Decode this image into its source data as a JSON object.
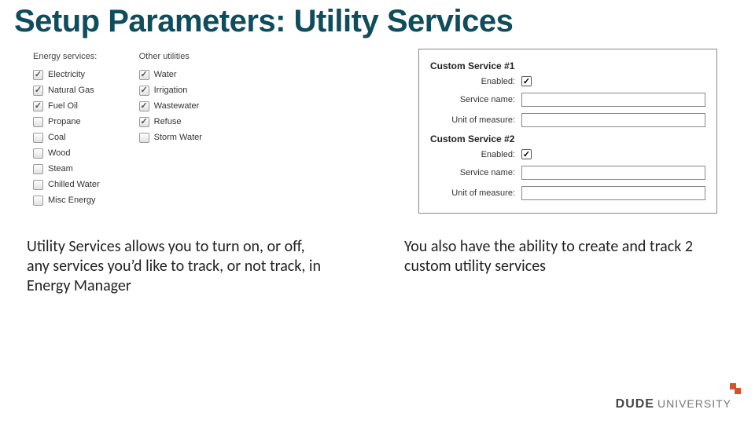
{
  "title": "Setup Parameters: Utility Services",
  "energy_header": "Energy services:",
  "other_header": "Other utilities",
  "energy_services": [
    {
      "label": "Electricity",
      "checked": true
    },
    {
      "label": "Natural Gas",
      "checked": true
    },
    {
      "label": "Fuel Oil",
      "checked": true
    },
    {
      "label": "Propane",
      "checked": false
    },
    {
      "label": "Coal",
      "checked": false
    },
    {
      "label": "Wood",
      "checked": false
    },
    {
      "label": "Steam",
      "checked": false
    },
    {
      "label": "Chilled Water",
      "checked": false
    },
    {
      "label": "Misc Energy",
      "checked": false
    }
  ],
  "other_utilities": [
    {
      "label": "Water",
      "checked": true
    },
    {
      "label": "Irrigation",
      "checked": true
    },
    {
      "label": "Wastewater",
      "checked": true
    },
    {
      "label": "Refuse",
      "checked": true
    },
    {
      "label": "Storm Water",
      "checked": false
    }
  ],
  "custom": [
    {
      "title": "Custom Service #1",
      "enabled_label": "Enabled:",
      "enabled_checked": true,
      "name_label": "Service name:",
      "name_value": "",
      "unit_label": "Unit of measure:",
      "unit_value": ""
    },
    {
      "title": "Custom Service #2",
      "enabled_label": "Enabled:",
      "enabled_checked": true,
      "name_label": "Service name:",
      "name_value": "",
      "unit_label": "Unit of measure:",
      "unit_value": ""
    }
  ],
  "caption_left": "Utility Services allows you to turn on, or off, any services you’d like to track, or not track, in Energy Manager",
  "caption_right": "You also have the ability to create and track 2 custom utility services",
  "footer": {
    "brand": "DUDE",
    "suffix": "UNIVERSITY"
  }
}
